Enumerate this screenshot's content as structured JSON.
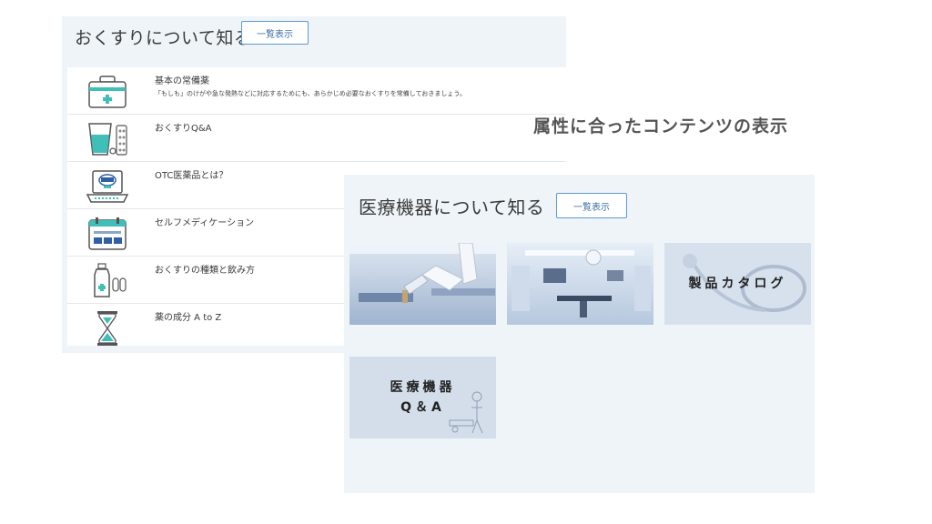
{
  "medicine_section": {
    "title": "おくすりについて知る",
    "list_button": "一覧表示",
    "items": [
      {
        "title": "基本の常備薬",
        "description": "「もしも」のけがや急な発熱などに対応するためにも、あらかじめ必要なおくすりを常備しておきましょう。",
        "icon": "first-aid-kit-icon"
      },
      {
        "title": "おくすりQ&A",
        "description": "",
        "icon": "water-glass-pills-icon"
      },
      {
        "title": "OTC医薬品とは？",
        "description": "",
        "icon": "otc-laptop-icon"
      },
      {
        "title": "セルフメディケーション",
        "description": "",
        "icon": "self-medication-calendar-icon"
      },
      {
        "title": "おくすりの種類と飲み方",
        "description": "",
        "icon": "medicine-bottle-icon"
      },
      {
        "title": "薬の成分 A to Z",
        "description": "",
        "icon": "hourglass-icon"
      }
    ]
  },
  "caption": "属性に合ったコンテンツの表示",
  "device_section": {
    "title": "医療機器について知る",
    "list_button": "一覧表示",
    "cards": [
      {
        "label": "",
        "image": "robotic-arm-surgery-photo"
      },
      {
        "label": "",
        "image": "operating-room-photo"
      },
      {
        "label": "製品カタログ",
        "image": "stethoscope-photo"
      },
      {
        "label": "医療機器\nQ＆A",
        "image": "doctor-illustration"
      }
    ]
  },
  "colors": {
    "panel_bg": "#eef4f8",
    "button_border": "#5b9bd5",
    "teal_accent": "#3fbfb8"
  }
}
